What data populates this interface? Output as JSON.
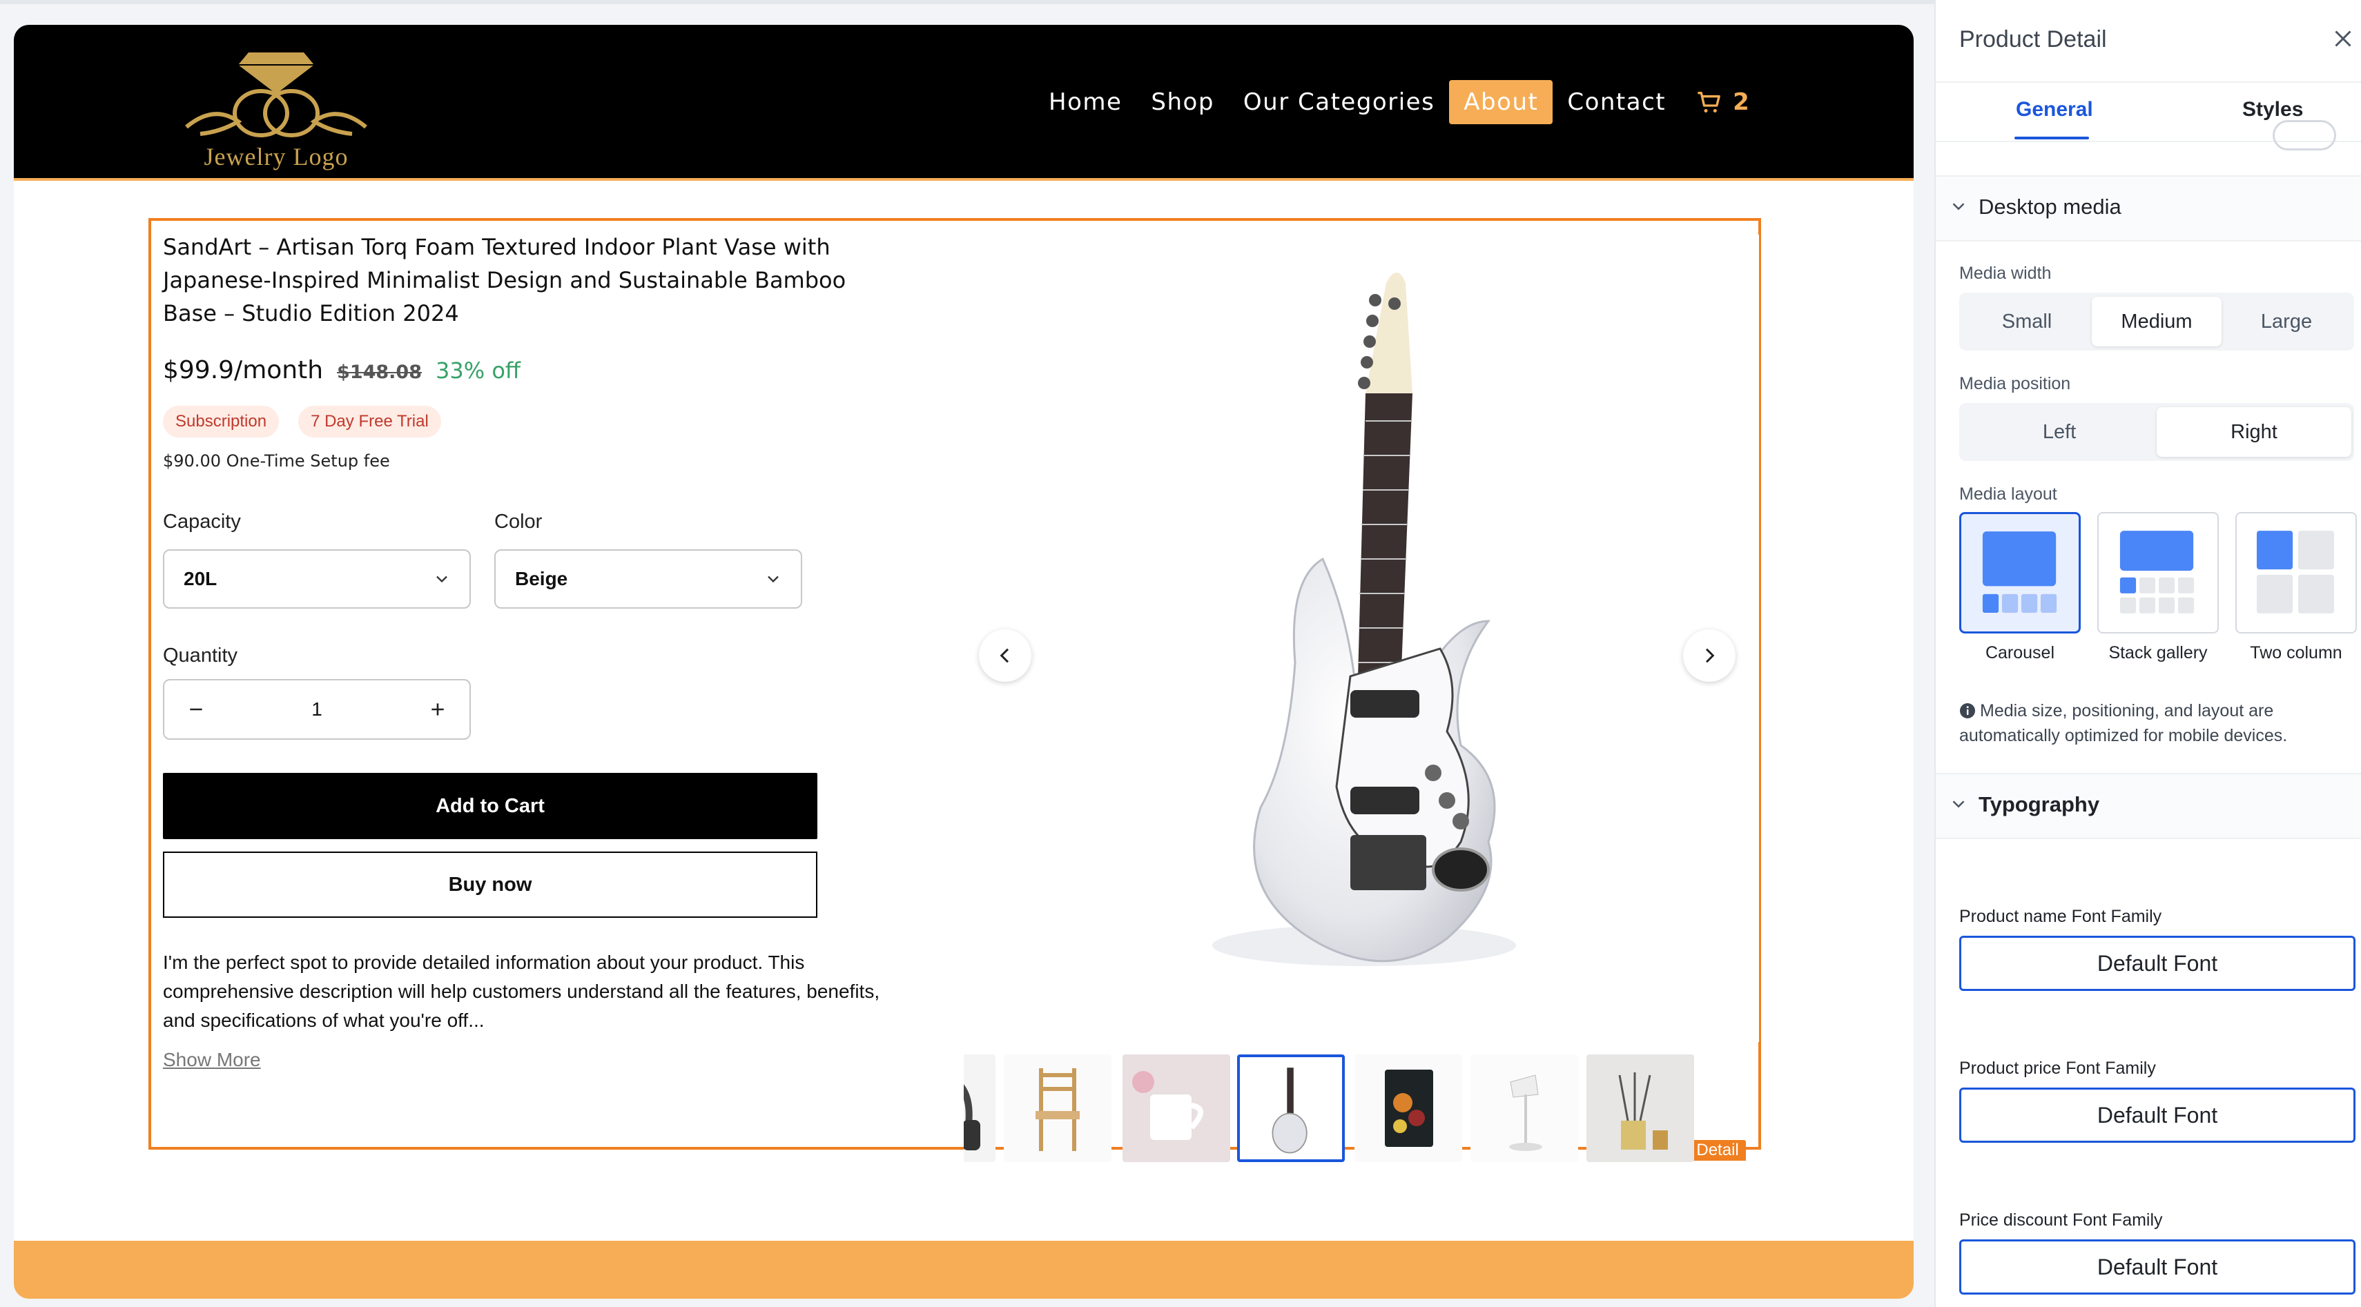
{
  "site": {
    "logo_text": "Jewelry Logo",
    "nav": [
      "Home",
      "Shop",
      "Our Categories",
      "About",
      "Contact"
    ],
    "active_nav": "About",
    "cart_count": "2"
  },
  "product": {
    "title": "SandArt – Artisan Torq Foam Textured Indoor Plant Vase with Japanese-Inspired Minimalist Design and Sustainable Bamboo Base – Studio Edition 2024",
    "price": "$99.9/month",
    "compare_price": "$148.08",
    "discount": "33% off",
    "tags": [
      "Subscription",
      "7 Day Free Trial"
    ],
    "setup_fee": "$90.00 One-Time Setup fee",
    "options": [
      {
        "label": "Capacity",
        "value": "20L"
      },
      {
        "label": "Color",
        "value": "Beige"
      }
    ],
    "quantity_label": "Quantity",
    "quantity": "1",
    "add_to_cart": "Add to Cart",
    "buy_now": "Buy now",
    "description": "I'm the perfect spot to provide detailed information about your product. This comprehensive description will help customers understand all the features, benefits, and specifications of what you're off...",
    "show_more": "Show More",
    "badge": "Product Detail"
  },
  "panel": {
    "title": "Product Detail",
    "tabs": [
      "General",
      "Styles"
    ],
    "active_tab": "General",
    "desktop_media": {
      "heading": "Desktop media",
      "media_width_label": "Media width",
      "media_width_options": [
        "Small",
        "Medium",
        "Large"
      ],
      "media_width_selected": "Medium",
      "media_position_label": "Media position",
      "media_position_options": [
        "Left",
        "Right"
      ],
      "media_position_selected": "Right",
      "media_layout_label": "Media layout",
      "media_layout_options": [
        "Carousel",
        "Stack gallery",
        "Two column"
      ],
      "media_layout_selected": "Carousel",
      "note": "Media size, positioning, and layout are automatically optimized for mobile devices."
    },
    "typography": {
      "heading": "Typography",
      "fields": [
        {
          "label": "Product name Font Family",
          "value": "Default Font"
        },
        {
          "label": "Product price Font Family",
          "value": "Default Font"
        },
        {
          "label": "Price discount Font Family",
          "value": "Default Font"
        }
      ]
    }
  },
  "colors": {
    "accent_orange": "#f6ad55",
    "selection_orange": "#f07f20",
    "primary_blue": "#1a56db",
    "discount_green": "#38a169"
  }
}
